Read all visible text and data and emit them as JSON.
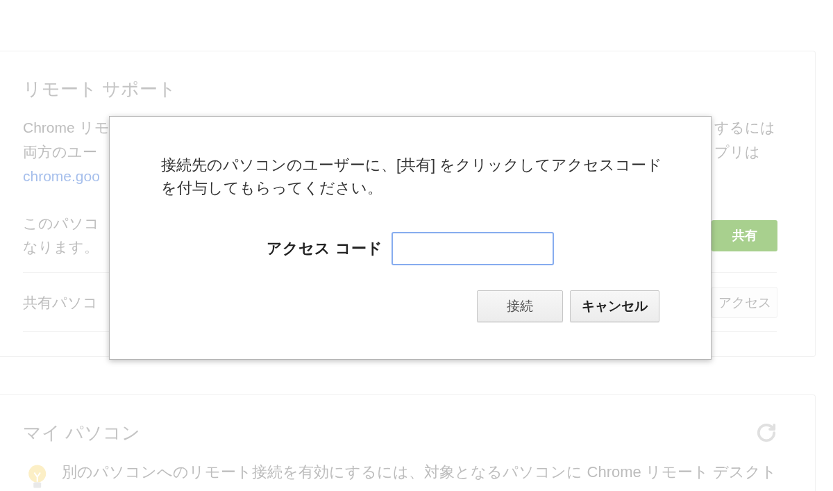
{
  "remote_support": {
    "title": "リモート サポート",
    "description_left": [
      {
        "kind": "text",
        "text": "Chrome リモ"
      },
      {
        "kind": "text",
        "text": "両方のユー"
      },
      {
        "kind": "link",
        "text": "chrome.goo"
      }
    ],
    "description_right": [
      "するには",
      "プリは"
    ],
    "this_computer_left": [
      "このパソコ",
      "なります。"
    ],
    "share_button": "共有",
    "shared_computers_label": "共有パソコ",
    "access_button": "アクセス"
  },
  "dialog": {
    "message": "接続先のパソコンのユーザーに、[共有] をクリックしてアクセスコードを付与してもらってください。",
    "access_code": {
      "label": "アクセス コード",
      "focused": true
    },
    "buttons": [
      {
        "label": "接続",
        "disabled": true
      },
      {
        "label": "キャンセル",
        "disabled": false
      }
    ]
  },
  "my_computers": {
    "title": "マイ パソコン",
    "notice": "別のパソコンへのリモート接続を有効にするには、対象となるパソコンに Chrome リモート デスクト"
  }
}
